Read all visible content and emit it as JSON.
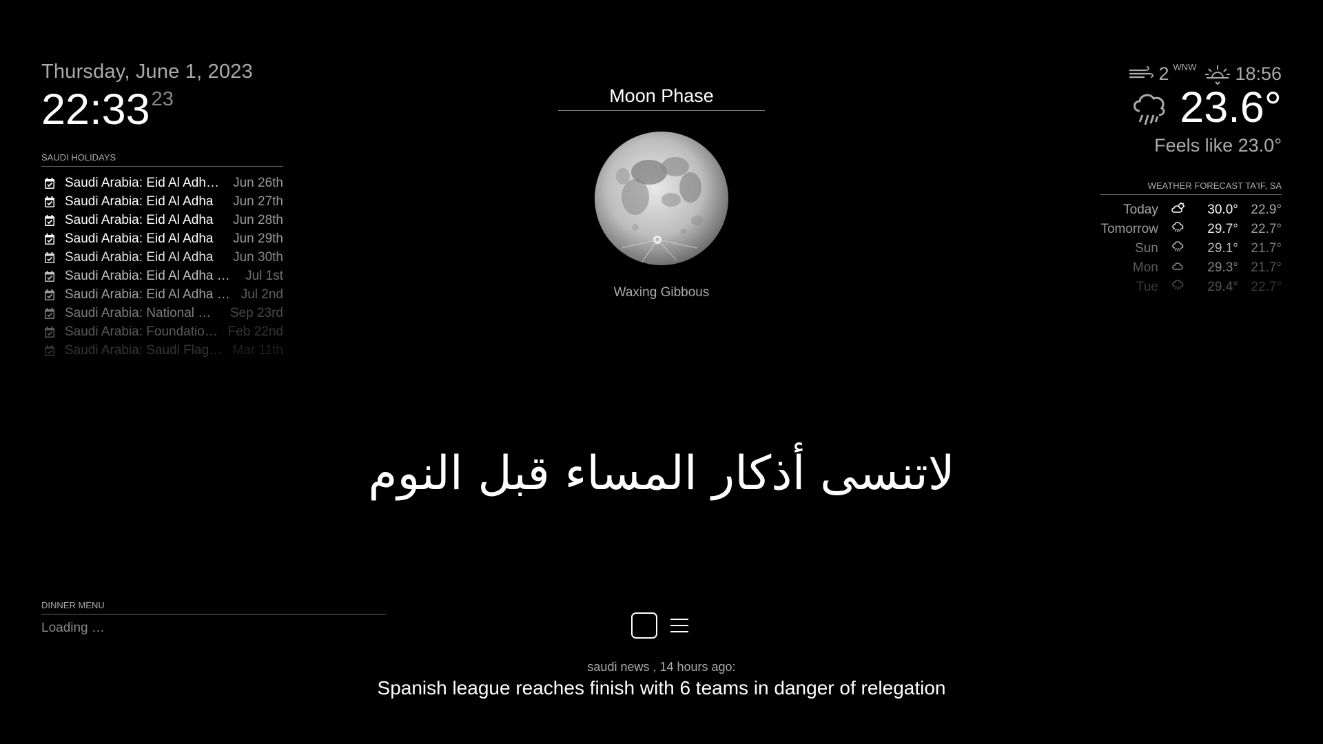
{
  "clock": {
    "date": "Thursday, June 1, 2023",
    "time": "22:33",
    "seconds": "23"
  },
  "holidays": {
    "header": "SAUDI HOLIDAYS",
    "items": [
      {
        "title": "Saudi Arabia: Eid Al Adha (Arafat Day)",
        "date": "Jun 26th",
        "opacity": 1.0
      },
      {
        "title": "Saudi Arabia: Eid Al Adha",
        "date": "Jun 27th",
        "opacity": 1.0
      },
      {
        "title": "Saudi Arabia: Eid Al Adha",
        "date": "Jun 28th",
        "opacity": 1.0
      },
      {
        "title": "Saudi Arabia: Eid Al Adha",
        "date": "Jun 29th",
        "opacity": 1.0
      },
      {
        "title": "Saudi Arabia: Eid Al Adha",
        "date": "Jun 30th",
        "opacity": 0.88
      },
      {
        "title": "Saudi Arabia: Eid Al Adha Holiday",
        "date": "Jul 1st",
        "opacity": 0.75
      },
      {
        "title": "Saudi Arabia: Eid Al Adha Holiday",
        "date": "Jul 2nd",
        "opacity": 0.62
      },
      {
        "title": "Saudi Arabia: National Day",
        "date": "Sep 23rd",
        "opacity": 0.48
      },
      {
        "title": "Saudi Arabia: Foundation Day",
        "date": "Feb 22nd",
        "opacity": 0.34
      },
      {
        "title": "Saudi Arabia: Saudi Flag Day",
        "date": "Mar 11th",
        "opacity": 0.2
      }
    ]
  },
  "moon": {
    "header": "Moon Phase",
    "phase": "Waxing Gibbous"
  },
  "current_weather": {
    "wind_speed": "2",
    "wind_direction": "WNW",
    "sunset_time": "18:56",
    "temperature": "23.6°",
    "feels_like": "Feels like 23.0°",
    "icon": "rain-cloud-icon"
  },
  "forecast": {
    "header": "WEATHER FORECAST TA'IF, SA",
    "days": [
      {
        "day": "Today",
        "icon": "partly-sunny-icon",
        "max": "30.0°",
        "min": "22.9°",
        "opacity": 1.0
      },
      {
        "day": "Tomorrow",
        "icon": "rain-cloud-icon",
        "max": "29.7°",
        "min": "22.7°",
        "opacity": 0.9
      },
      {
        "day": "Sun",
        "icon": "rain-cloud-icon",
        "max": "29.1°",
        "min": "21.7°",
        "opacity": 0.72
      },
      {
        "day": "Mon",
        "icon": "cloud-icon",
        "max": "29.3°",
        "min": "21.7°",
        "opacity": 0.52
      },
      {
        "day": "Tue",
        "icon": "rain-cloud-icon",
        "max": "29.4°",
        "min": "22.7°",
        "opacity": 0.32
      }
    ]
  },
  "compliment": {
    "text": "لاتنسى أذكار المساء قبل النوم"
  },
  "dinner": {
    "header": "DINNER MENU",
    "status": "Loading …"
  },
  "news": {
    "source": "saudi news , 14 hours ago:",
    "title": "Spanish league reaches finish with 6 teams in danger of relegation"
  }
}
